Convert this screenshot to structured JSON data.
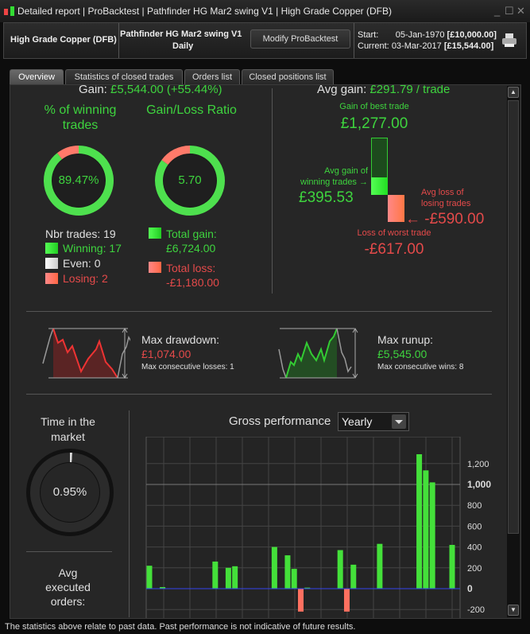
{
  "window": {
    "title_parts": [
      "Detailed report",
      "ProBacktest",
      "Pathfinder HG Mar2 swing V1",
      "High Grade Copper (DFB)"
    ]
  },
  "header": {
    "instrument": "High Grade Copper (DFB)",
    "system": "Pathfinder HG Mar2 swing V1",
    "timeframe": "Daily",
    "modify_label": "Modify ProBacktest",
    "start_label": "Start:",
    "start_date": "05-Jan-1970",
    "start_value": "[£10,000.00]",
    "current_label": "Current:",
    "current_date": "03-Mar-2017",
    "current_value": "[£15,544.00]"
  },
  "tabs": [
    {
      "label": "Overview",
      "active": true
    },
    {
      "label": "Statistics of closed trades"
    },
    {
      "label": "Orders list"
    },
    {
      "label": "Closed positions list"
    }
  ],
  "overview": {
    "gain_label": "Gain:",
    "gain_value": "£5,544.00 (+55.44%)",
    "avg_gain_label": "Avg gain:",
    "avg_gain_value": "£291.79 / trade",
    "win_title": "% of winning trades",
    "win_pct": "89.47%",
    "win_fraction": 0.8947,
    "ratio_title": "Gain/Loss Ratio",
    "ratio_value": "5.70",
    "ratio_gain_fraction": 0.85,
    "nbr_trades": "Nbr trades: 19",
    "winning": "Winning: 17",
    "even": "Even: 0",
    "losing": "Losing: 2",
    "total_gain_label": "Total gain:",
    "total_gain": "£6,724.00",
    "total_loss_label": "Total loss:",
    "total_loss": "-£1,180.00",
    "best_label": "Gain of best trade",
    "best_value": "£1,277.00",
    "avg_win_label1": "Avg gain of",
    "avg_win_label2": "winning trades",
    "avg_win_value": "£395.53",
    "avg_loss_label1": "Avg loss of",
    "avg_loss_label2": "losing trades",
    "avg_loss_value": "-£590.00",
    "worst_label": "Loss of worst trade",
    "worst_value": "-£617.00",
    "drawdown_label": "Max drawdown:",
    "drawdown_value": "£1,074.00",
    "max_cons_losses": "Max consecutive losses: 1",
    "runup_label": "Max runup:",
    "runup_value": "£5,545.00",
    "max_cons_wins": "Max consecutive wins: 8",
    "time_market_title1": "Time in the",
    "time_market_title2": "market",
    "time_market_value": "0.95%",
    "time_market_fraction": 0.0095,
    "avg_exec_1": "Avg",
    "avg_exec_2": "executed",
    "avg_exec_3": "orders:",
    "gross_title": "Gross performance",
    "period_select": "Yearly"
  },
  "colors": {
    "gain": "#3ed43e",
    "loss": "#e44a4a",
    "bar_up": "#44e03a",
    "bar_down": "#ff7060"
  },
  "chart_data": {
    "type": "bar",
    "title": "Gross performance",
    "ylim": [
      -200,
      1400
    ],
    "yticks": [
      "1,200",
      "1,000",
      "800",
      "600",
      "400",
      "200",
      "0",
      "-200"
    ],
    "ytick_values": [
      1200,
      1000,
      800,
      600,
      400,
      200,
      0,
      -200
    ],
    "grid": true,
    "values": [
      220,
      0,
      15,
      0,
      0,
      0,
      0,
      0,
      0,
      0,
      260,
      0,
      200,
      215,
      0,
      0,
      0,
      0,
      0,
      400,
      0,
      320,
      190,
      -220,
      10,
      0,
      0,
      0,
      0,
      370,
      -220,
      230,
      0,
      0,
      0,
      430,
      0,
      0,
      0,
      0,
      0,
      1290,
      1135,
      1020,
      0,
      0,
      420
    ]
  },
  "footer": "The statistics above relate to past data. Past performance is not indicative of future results."
}
